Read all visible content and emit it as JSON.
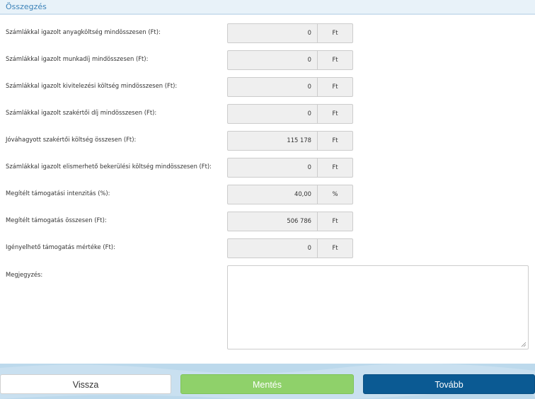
{
  "section": {
    "title": "Összegzés"
  },
  "rows": [
    {
      "label": "Számlákkal igazolt anyagköltség mindösszesen (Ft):",
      "value": "0",
      "unit": "Ft"
    },
    {
      "label": "Számlákkal igazolt munkadíj mindösszesen (Ft):",
      "value": "0",
      "unit": "Ft"
    },
    {
      "label": "Számlákkal igazolt kivitelezési költség mindösszesen (Ft):",
      "value": "0",
      "unit": "Ft"
    },
    {
      "label": "Számlákkal igazolt szakértői díj mindösszesen (Ft):",
      "value": "0",
      "unit": "Ft"
    },
    {
      "label": "Jóváhagyott szakértői költség összesen (Ft):",
      "value": "115 178",
      "unit": "Ft"
    },
    {
      "label": "Számlákkal igazolt elismerhető bekerülési költség mindösszesen (Ft):",
      "value": "0",
      "unit": "Ft"
    },
    {
      "label": "Megítélt támogatási intenzitás (%):",
      "value": "40,00",
      "unit": "%"
    },
    {
      "label": "Megítélt támogatás összesen (Ft):",
      "value": "506 786",
      "unit": "Ft"
    },
    {
      "label": "Igényelhető támogatás mértéke (Ft):",
      "value": "0",
      "unit": "Ft"
    }
  ],
  "notes": {
    "label": "Megjegyzés:",
    "value": ""
  },
  "buttons": {
    "back": "Vissza",
    "save": "Mentés",
    "next": "Tovább"
  },
  "colors": {
    "accent": "#3b82b8",
    "save": "#8fd16a",
    "next": "#0b5a93",
    "footer": "#c9e0f0"
  }
}
